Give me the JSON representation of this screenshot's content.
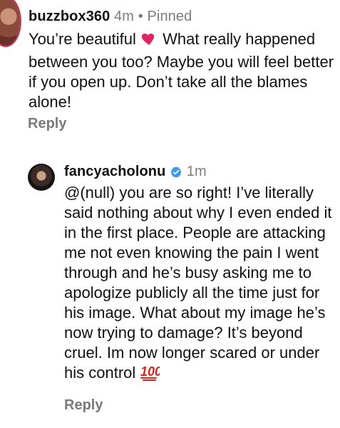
{
  "comments": [
    {
      "username": "buzzbox360",
      "time": "4m",
      "separator": "•",
      "pinned": "Pinned",
      "text_before": "You’re beautiful",
      "text_after": " What really happened between you too? Maybe you will feel better if you open up. Don’t take all the blames alone!",
      "reply_label": "Reply",
      "icons": [
        "heart-icon"
      ]
    },
    {
      "username": "fancyacholonu",
      "verified": true,
      "time": "1m",
      "text": "@(null) you are so right! I’ve literally said nothing about why I even ended it in the first place. People are attacking me not even knowing the pain I went through and he’s busy asking me to apologize publicly all the time just for his image. What about my image he’s now trying to damage? It’s beyond cruel. Im now longer scared or under his control",
      "reply_label": "Reply",
      "icons": [
        "verified-icon",
        "hundred-icon"
      ]
    }
  ],
  "colors": {
    "text": "#111111",
    "muted": "#7c7c7c",
    "verified": "#3897f0",
    "heart": "#e0245e",
    "hundred": "#d9231f"
  }
}
